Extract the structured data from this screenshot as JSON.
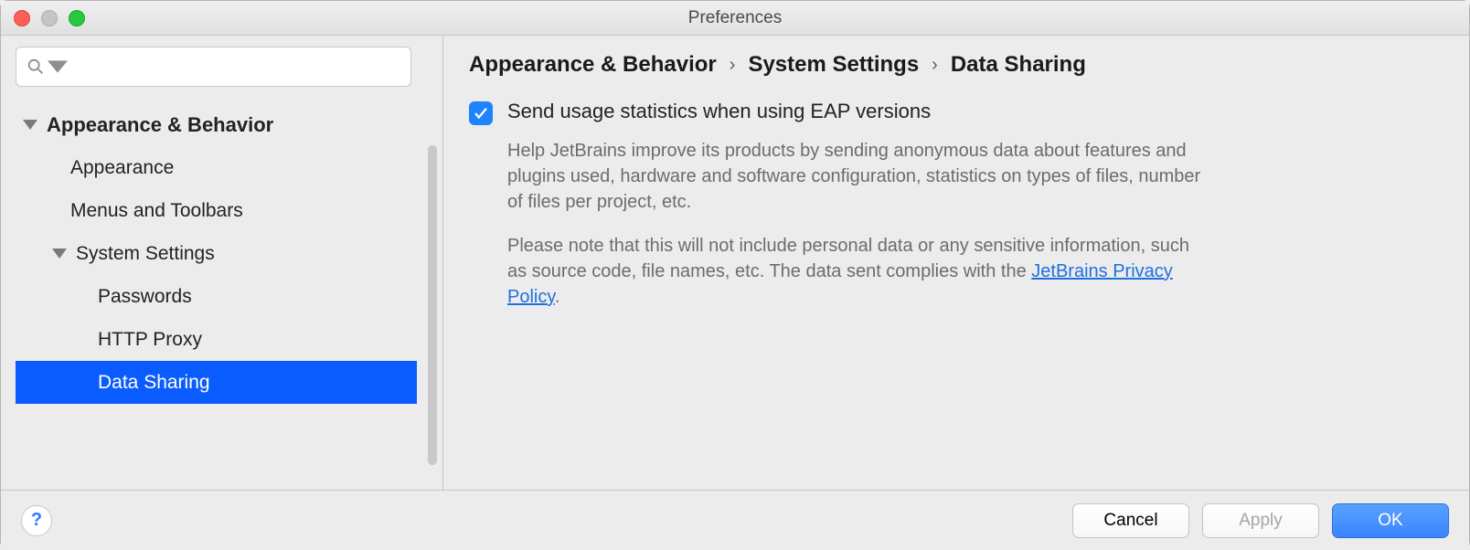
{
  "window": {
    "title": "Preferences"
  },
  "search": {
    "placeholder": ""
  },
  "sidebar": {
    "items": [
      {
        "label": "Appearance & Behavior",
        "level": 0,
        "expanded": true
      },
      {
        "label": "Appearance",
        "level": 1
      },
      {
        "label": "Menus and Toolbars",
        "level": 1
      },
      {
        "label": "System Settings",
        "level": 1,
        "expanded": true
      },
      {
        "label": "Passwords",
        "level": 2
      },
      {
        "label": "HTTP Proxy",
        "level": 2
      },
      {
        "label": "Data Sharing",
        "level": 2,
        "selected": true
      }
    ]
  },
  "breadcrumb": {
    "parts": [
      "Appearance & Behavior",
      "System Settings",
      "Data Sharing"
    ],
    "sep": "›"
  },
  "option": {
    "checked": true,
    "label": "Send usage statistics when using EAP versions",
    "help1": "Help JetBrains improve its products by sending anonymous data about features and plugins used, hardware and software configuration, statistics on types of files, number of files per project, etc.",
    "help2a": "Please note that this will not include personal data or any sensitive information, such as source code, file names, etc. The data sent complies with the ",
    "link": "JetBrains Privacy Policy",
    "help2b": "."
  },
  "footer": {
    "help": "?",
    "cancel": "Cancel",
    "apply": "Apply",
    "ok": "OK"
  }
}
